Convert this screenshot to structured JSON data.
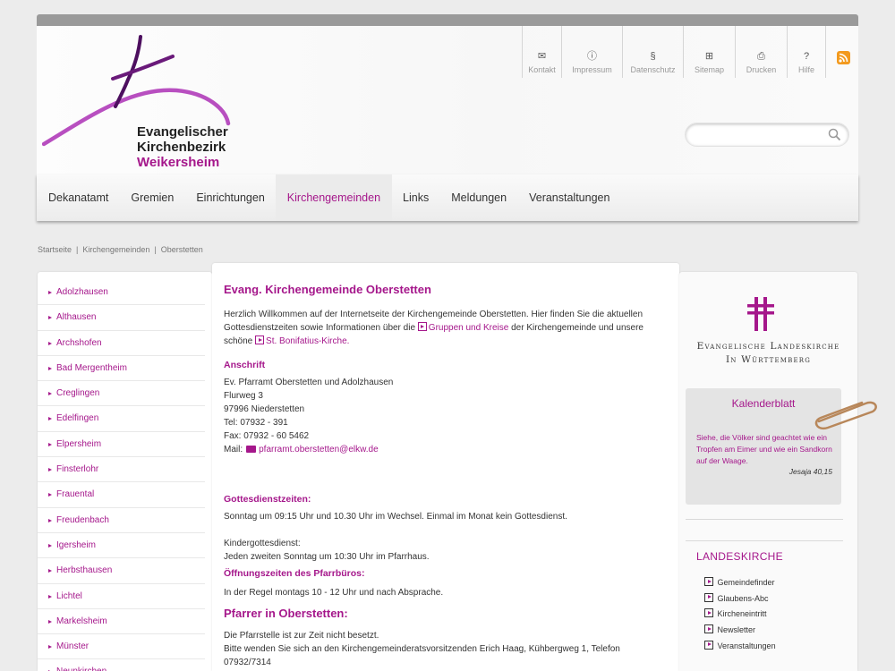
{
  "logo": {
    "line1": "Evangelischer",
    "line2": "Kirchenbezirk",
    "line3": "Weikersheim"
  },
  "toolbar": [
    {
      "icon": "envelope-icon",
      "label": "Kontakt"
    },
    {
      "icon": "info-icon",
      "label": "Impressum"
    },
    {
      "icon": "paragraph-icon",
      "label": "Datenschutz"
    },
    {
      "icon": "sitemap-icon",
      "label": "Sitemap"
    },
    {
      "icon": "printer-icon",
      "label": "Drucken"
    },
    {
      "icon": "help-icon",
      "label": "Hilfe"
    }
  ],
  "search": {
    "placeholder": ""
  },
  "nav": [
    "Dekanatamt",
    "Gremien",
    "Einrichtungen",
    "Kirchengemeinden",
    "Links",
    "Meldungen",
    "Veranstaltungen"
  ],
  "nav_active": "Kirchengemeinden",
  "breadcrumb": [
    "Startseite",
    "Kirchengemeinden",
    "Oberstetten"
  ],
  "sidebar": [
    "Adolzhausen",
    "Althausen",
    "Archshofen",
    "Bad Mergentheim",
    "Creglingen",
    "Edelfingen",
    "Elpersheim",
    "Finsterlohr",
    "Frauental",
    "Freudenbach",
    "Igersheim",
    "Herbsthausen",
    "Lichtel",
    "Markelsheim",
    "Münster",
    "Neunkirchen"
  ],
  "content": {
    "title": "Evang. Kirchengemeinde Oberstetten",
    "intro_1": "Herzlich Willkommen auf der Internetseite der Kirchengemeinde Oberstetten. Hier finden Sie die aktuellen Gottesdienstzeiten sowie Informationen über die",
    "intro_link1": "Gruppen und Kreise",
    "intro_2": "der Kirchengemeinde und unsere schöne",
    "intro_link2": "St. Bonifatius-Kirche.",
    "address_heading": "Anschrift",
    "address": [
      "Ev. Pfarramt Oberstetten und Adolzhausen",
      "Flurweg 3",
      "97996 Niederstetten",
      "Tel: 07932 - 391",
      "Fax: 07932 - 60 5462"
    ],
    "mail_label": "Mail:",
    "mail": "pfarramt.oberstetten@elkw.de",
    "services_heading": "Gottesdienstzeiten:",
    "services": "Sonntag um 09:15 Uhr und 10.30 Uhr im Wechsel. Einmal im Monat kein Gottesdienst.",
    "kids_label": "Kindergottesdienst:",
    "kids": "Jeden zweiten Sonntag um 10:30 Uhr im Pfarrhaus.",
    "office_heading": "Öffnungszeiten des Pfarrbüros:",
    "office": "In der Regel montags 10 - 12 Uhr und nach Absprache.",
    "pastor_heading": "Pfarrer in Oberstetten:",
    "pastor_1": "Die Pfarrstelle ist zur Zeit nicht besetzt.",
    "pastor_2": "Bitte wenden Sie sich an den Kirchengemeinderatsvorsitzenden Erich Haag, Kühbergweg 1, Telefon 07932/7314"
  },
  "right": {
    "church_line1": "Evangelische Landeskirche",
    "church_line2": "In Württemberg",
    "calendar_title": "Kalenderblatt",
    "verse": "Siehe, die Völker sind geachtet wie ein Tropfen am Eimer und wie ein Sandkorn auf der Waage.",
    "verse_source": "Jesaja 40,15",
    "landeskirche_heading": "LANDESKIRCHE",
    "links": [
      "Gemeindefinder",
      "Glaubens-Abc",
      "Kircheneintritt",
      "Newsletter",
      "Veranstaltungen"
    ]
  },
  "colors": {
    "accent": "#a5178b",
    "background": "#ececec"
  }
}
